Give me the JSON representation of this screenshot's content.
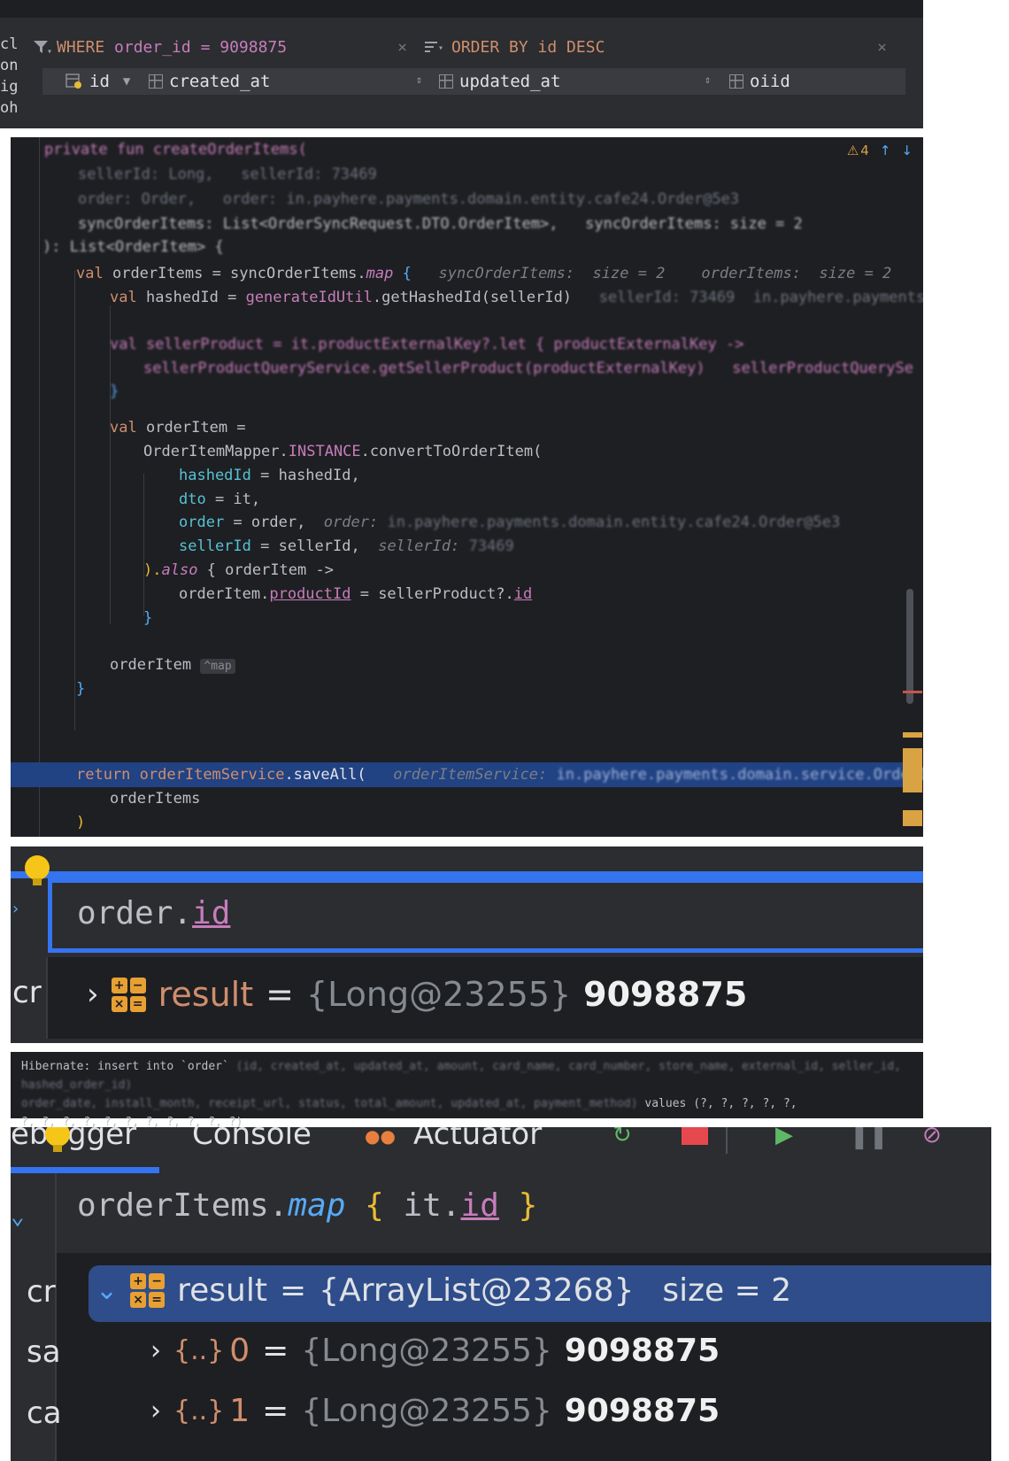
{
  "db_panel": {
    "left_col_fragments": [
      "cl",
      "on",
      "ig",
      "oh"
    ],
    "where_keyword": "WHERE",
    "where_expr": "order_id = 9098875",
    "order_keyword": "ORDER BY",
    "order_expr": "id DESC",
    "close_glyph": "×",
    "columns": [
      "id",
      "created_at",
      "updated_at",
      "oiid"
    ]
  },
  "editor": {
    "warning_count": "4",
    "line_val_orderitems": "val",
    "orderitems_var": "orderItems",
    "sync_items": "syncOrderItems",
    "map_fn": "map",
    "hint_sync": "syncOrderItems:  size = 2",
    "hint_orderitems": "orderItems:  size = 2",
    "hashed_val": "val",
    "hashed_var": "hashedId",
    "generate_util": "generateIdUtil",
    "get_hashed": ".getHashedId(sellerId)",
    "orderitem_val": "val",
    "orderitem_var": "orderItem",
    "mapper": "OrderItemMapper.",
    "instance": "INSTANCE",
    "convert": ".convertToOrderItem(",
    "arg_hashed_name": "hashedId",
    "arg_hashed_val": " = hashedId,",
    "arg_dto_name": "dto",
    "arg_dto_val": " = it,",
    "arg_order_name": "order",
    "arg_order_val": " = order,",
    "hint_order": "order:",
    "arg_seller_name": "sellerId",
    "arg_seller_val": " = sellerId,",
    "hint_seller": "sellerId:",
    "also_close": ").",
    "also_fn": "also",
    "also_rest": " { orderItem ->",
    "product_left": "orderItem.",
    "product_field": "productId",
    "product_mid": " = sellerProduct?.",
    "product_id": "id",
    "close_brace": "}",
    "ret_item": "orderItem",
    "map_hint": "^map",
    "return_kw": "return",
    "service": "orderItemService",
    "save_all": ".saveAll(",
    "hint_service": "orderItemService:",
    "ret_arg": "orderItems",
    "close_paren": ")"
  },
  "eval1": {
    "expr_prefix": "order.",
    "expr_field": "id",
    "side_cut": "cr",
    "result_label": "result",
    "result_ref": "{Long@23255}",
    "result_value": "9098875"
  },
  "hibernate": {
    "prefix": "Hibernate: insert into `order`",
    "values": "values (?, ?, ?, ?, ?,",
    "line3": "?, ?, ?, ?, ?, ?, ?, ?, ?, ?, ?)"
  },
  "debugger": {
    "tabs": [
      "ebugger",
      "Console",
      "Actuator"
    ],
    "expr_obj": "orderItems.",
    "expr_fn": "map",
    "expr_open": "{",
    "expr_it": " it.",
    "expr_field": "id",
    "expr_close": "}",
    "side_fragments": [
      "cr",
      "sa",
      "ca"
    ],
    "result_label": "result",
    "result_ref": "{ArrayList@23268}",
    "result_size": "size = 2",
    "items": [
      {
        "index": "0",
        "ref": "{Long@23255}",
        "value": "9098875"
      },
      {
        "index": "1",
        "ref": "{Long@23255}",
        "value": "9098875"
      }
    ]
  }
}
